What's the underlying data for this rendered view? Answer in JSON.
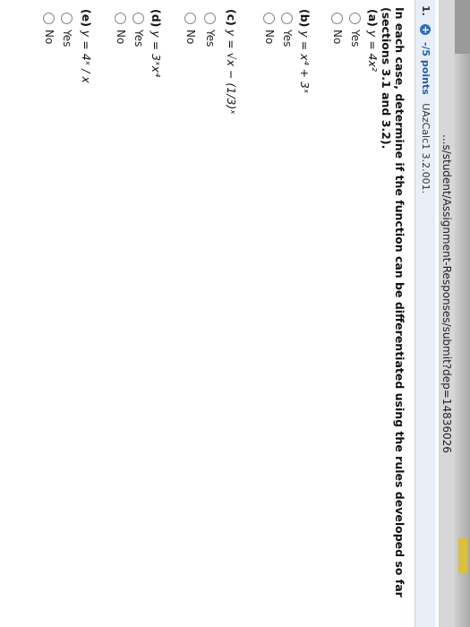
{
  "browser": {
    "url_fragment": "...s/student/Assignment-Responses/submit?dep=14836026"
  },
  "question": {
    "number": "1.",
    "plus_glyph": "+",
    "points": "-/5 points",
    "code": "UAzCalc1 3.2.001.",
    "instructions": "In each case, determine if the function can be differentiated using the rules developed so far (sections 3.1 and 3.2).",
    "parts": [
      {
        "label": "(a)",
        "formula": "y = 4x²",
        "options": [
          "Yes",
          "No"
        ]
      },
      {
        "label": "(b)",
        "formula": "y = x⁴ + 3ˣ",
        "options": [
          "Yes",
          "No"
        ]
      },
      {
        "label": "(c)",
        "formula": "y = √x − (1/3)ˣ",
        "options": [
          "Yes",
          "No"
        ]
      },
      {
        "label": "(d)",
        "formula": "y = 3ˣx⁴",
        "options": [
          "Yes",
          "No"
        ]
      },
      {
        "label": "(e)",
        "formula": "y = 4ˣ / x",
        "options": [
          "Yes",
          "No"
        ]
      }
    ]
  }
}
